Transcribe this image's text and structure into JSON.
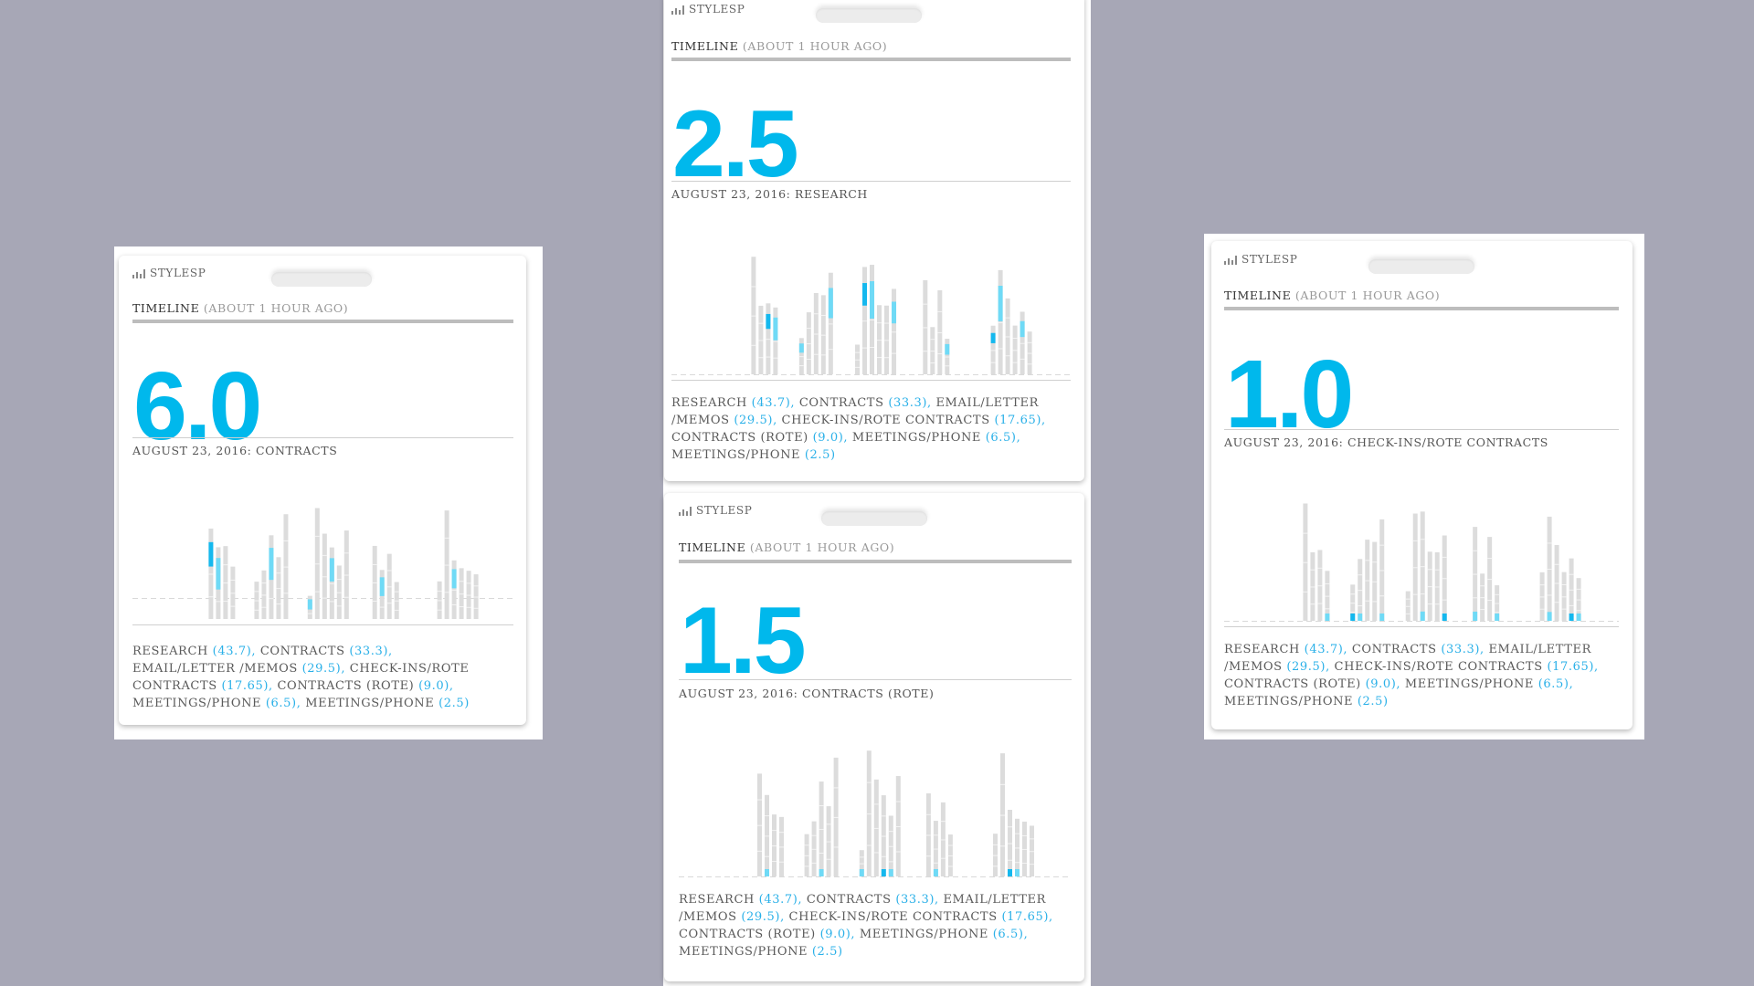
{
  "background_color": "#a7a7b6",
  "accent_color": "#00b8ec",
  "widgets": [
    {
      "brand": "STYLESP",
      "timeline_label": "TIMELINE",
      "timeline_sub": "(ABOUT 1 HOUR AGO)",
      "value": "6.0",
      "date_label": "AUGUST 23, 2016: CONTRACTS",
      "legend": [
        {
          "name": "RESEARCH",
          "value": "(43.7)"
        },
        {
          "name": "CONTRACTS",
          "value": "(33.3)"
        },
        {
          "name": "EMAIL/LETTER /MEMOS",
          "value": "(29.5)"
        },
        {
          "name": "CHECK-INS/ROTE CONTRACTS",
          "value": "(17.65)"
        },
        {
          "name": "CONTRACTS (ROTE)",
          "value": "(9.0)"
        },
        {
          "name": "MEETINGS/PHONE",
          "value": "(6.5)"
        },
        {
          "name": "MEETINGS/PHONE",
          "value": "(2.5)"
        }
      ]
    },
    {
      "brand": "STYLESP",
      "timeline_label": "TIMELINE",
      "timeline_sub": "(ABOUT 1 HOUR AGO)",
      "value": "2.5",
      "date_label": "AUGUST 23, 2016: RESEARCH",
      "legend": [
        {
          "name": "RESEARCH",
          "value": "(43.7)"
        },
        {
          "name": "CONTRACTS",
          "value": "(33.3)"
        },
        {
          "name": "EMAIL/LETTER /MEMOS",
          "value": "(29.5)"
        },
        {
          "name": "CHECK-INS/ROTE CONTRACTS",
          "value": "(17.65)"
        },
        {
          "name": "CONTRACTS (ROTE)",
          "value": "(9.0)"
        },
        {
          "name": "MEETINGS/PHONE",
          "value": "(6.5)"
        },
        {
          "name": "MEETINGS/PHONE",
          "value": "(2.5)"
        }
      ]
    },
    {
      "brand": "STYLESP",
      "timeline_label": "TIMELINE",
      "timeline_sub": "(ABOUT 1 HOUR AGO)",
      "value": "1.5",
      "date_label": "AUGUST 23, 2016: CONTRACTS (ROTE)",
      "legend": [
        {
          "name": "RESEARCH",
          "value": "(43.7)"
        },
        {
          "name": "CONTRACTS",
          "value": "(33.3)"
        },
        {
          "name": "EMAIL/LETTER /MEMOS",
          "value": "(29.5)"
        },
        {
          "name": "CHECK-INS/ROTE CONTRACTS",
          "value": "(17.65)"
        },
        {
          "name": "CONTRACTS (ROTE)",
          "value": "(9.0)"
        },
        {
          "name": "MEETINGS/PHONE",
          "value": "(6.5)"
        },
        {
          "name": "MEETINGS/PHONE",
          "value": "(2.5)"
        }
      ]
    },
    {
      "brand": "STYLESP",
      "timeline_label": "TIMELINE",
      "timeline_sub": "(ABOUT 1 HOUR AGO)",
      "value": "1.0",
      "date_label": "AUGUST 23, 2016: CHECK-INS/ROTE CONTRACTS",
      "legend": [
        {
          "name": "RESEARCH",
          "value": "(43.7)"
        },
        {
          "name": "CONTRACTS",
          "value": "(33.3)"
        },
        {
          "name": "EMAIL/LETTER /MEMOS",
          "value": "(29.5)"
        },
        {
          "name": "CHECK-INS/ROTE CONTRACTS",
          "value": "(17.65)"
        },
        {
          "name": "CONTRACTS (ROTE)",
          "value": "(9.0)"
        },
        {
          "name": "MEETINGS/PHONE",
          "value": "(6.5)"
        },
        {
          "name": "MEETINGS/PHONE",
          "value": "(2.5)"
        }
      ]
    }
  ],
  "chart_data": [
    {
      "type": "bar",
      "stacked": true,
      "grid": false,
      "bars": [
        [
          0,
          0,
          0,
          0,
          0,
          0,
          0,
          0,
          0,
          0,
          0,
          0,
          0,
          0,
          0,
          0,
          0,
          0,
          0,
          0,
          0,
          0,
          0,
          0,
          0,
          0,
          0,
          0,
          0,
          0,
          0,
          0,
          0,
          0,
          0,
          0,
          0,
          0,
          0,
          0,
          0,
          0,
          0,
          0,
          0,
          0,
          0,
          0
        ],
        [
          0.4,
          0.5,
          0.85,
          0.35,
          0.4,
          0.3,
          0.6,
          0.8,
          0.5,
          0.45,
          0.4,
          0.75,
          0.55,
          0.3,
          0.7,
          0.35,
          0.5,
          0.5,
          0.3,
          0.75,
          0.5,
          0.3,
          0.4,
          0.5,
          0.4
        ]
      ],
      "highlight_value": 6.0,
      "highlight_category": "CONTRACTS"
    },
    {
      "type": "bar",
      "stacked": true,
      "grid": false,
      "highlight_value": 2.5,
      "highlight_category": "RESEARCH"
    },
    {
      "type": "bar",
      "stacked": true,
      "grid": false,
      "highlight_value": 1.5,
      "highlight_category": "CONTRACTS (ROTE)"
    },
    {
      "type": "bar",
      "stacked": true,
      "grid": false,
      "highlight_value": 1.0,
      "highlight_category": "CHECK-INS/ROTE CONTRACTS"
    }
  ]
}
